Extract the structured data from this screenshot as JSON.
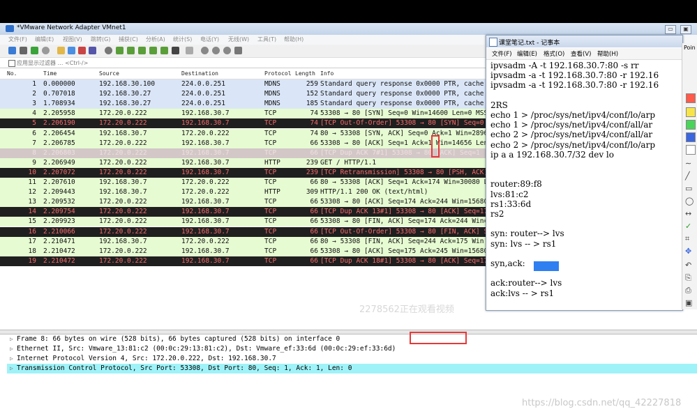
{
  "wireshark": {
    "title": "*VMware Network Adapter VMnet1",
    "menu": [
      "文件(F)",
      "编辑(E)",
      "视图(V)",
      "跳转(G)",
      "捕获(C)",
      "分析(A)",
      "统计(S)",
      "电话(Y)",
      "无线(W)",
      "工具(T)",
      "帮助(H)"
    ],
    "filter_placeholder": "应用显示过滤器 … <Ctrl-/>",
    "columns": [
      "No.",
      "Time",
      "Source",
      "Destination",
      "Protocol",
      "Length",
      "Info"
    ],
    "packets": [
      {
        "no": "1",
        "time": "0.000000",
        "src": "192.168.30.100",
        "dst": "224.0.0.251",
        "proto": "MDNS",
        "len": "259",
        "info": "Standard query response 0x0000 PTR, cache"
      },
      {
        "no": "2",
        "time": "0.707018",
        "src": "192.168.30.27",
        "dst": "224.0.0.251",
        "proto": "MDNS",
        "len": "152",
        "info": "Standard query response 0x0000 PTR, cache"
      },
      {
        "no": "3",
        "time": "1.708934",
        "src": "192.168.30.27",
        "dst": "224.0.0.251",
        "proto": "MDNS",
        "len": "185",
        "info": "Standard query response 0x0000 PTR, cache"
      },
      {
        "no": "4",
        "time": "2.205958",
        "src": "172.20.0.222",
        "dst": "192.168.30.7",
        "proto": "TCP",
        "len": "74",
        "info": "53308 → 80 [SYN] Seq=0 Win=14600 Len=0 MSS"
      },
      {
        "no": "5",
        "time": "2.206190",
        "src": "172.20.0.222",
        "dst": "192.168.30.7",
        "proto": "TCP",
        "len": "74",
        "info": "[TCP Out-Of-Order] 53308 → 80 [SYN] Seq=0"
      },
      {
        "no": "6",
        "time": "2.206454",
        "src": "192.168.30.7",
        "dst": "172.20.0.222",
        "proto": "TCP",
        "len": "74",
        "info": "80 → 53308 [SYN, ACK] Seq=0 Ack=1 Win=2896"
      },
      {
        "no": "7",
        "time": "2.206785",
        "src": "172.20.0.222",
        "dst": "192.168.30.7",
        "proto": "TCP",
        "len": "66",
        "info": "53308 → 80 [ACK] Seq=1 Ack=1 Win=14656 Len"
      },
      {
        "no": "8",
        "time": "2.206803",
        "src": "172.20.0.222",
        "dst": "192.168.30.7",
        "proto": "TCP",
        "len": "66",
        "info": "[TCP Dup ACK 7#1] 53308 → 80 [ACK] Seq=1"
      },
      {
        "no": "9",
        "time": "2.206949",
        "src": "172.20.0.222",
        "dst": "192.168.30.7",
        "proto": "HTTP",
        "len": "239",
        "info": "GET / HTTP/1.1"
      },
      {
        "no": "10",
        "time": "2.207072",
        "src": "172.20.0.222",
        "dst": "192.168.30.7",
        "proto": "TCP",
        "len": "239",
        "info": "[TCP Retransmission] 53308 → 80 [PSH, ACK]"
      },
      {
        "no": "11",
        "time": "2.207610",
        "src": "192.168.30.7",
        "dst": "172.20.0.222",
        "proto": "TCP",
        "len": "66",
        "info": "80 → 53308 [ACK] Seq=1 Ack=174 Win=30080 L"
      },
      {
        "no": "12",
        "time": "2.209443",
        "src": "192.168.30.7",
        "dst": "172.20.0.222",
        "proto": "HTTP",
        "len": "309",
        "info": "HTTP/1.1 200 OK  (text/html)"
      },
      {
        "no": "13",
        "time": "2.209532",
        "src": "172.20.0.222",
        "dst": "192.168.30.7",
        "proto": "TCP",
        "len": "66",
        "info": "53308 → 80 [ACK] Seq=174 Ack=244 Win=15680"
      },
      {
        "no": "14",
        "time": "2.209754",
        "src": "172.20.0.222",
        "dst": "192.168.30.7",
        "proto": "TCP",
        "len": "66",
        "info": "[TCP Dup ACK 13#1] 53308 → 80 [ACK] Seq=17"
      },
      {
        "no": "15",
        "time": "2.209923",
        "src": "172.20.0.222",
        "dst": "192.168.30.7",
        "proto": "TCP",
        "len": "66",
        "info": "53308 → 80 [FIN, ACK] Seq=174 Ack=244 Win="
      },
      {
        "no": "16",
        "time": "2.210066",
        "src": "172.20.0.222",
        "dst": "192.168.30.7",
        "proto": "TCP",
        "len": "66",
        "info": "[TCP Out-Of-Order] 53308 → 80 [FIN, ACK] S"
      },
      {
        "no": "17",
        "time": "2.210471",
        "src": "192.168.30.7",
        "dst": "172.20.0.222",
        "proto": "TCP",
        "len": "66",
        "info": "80 → 53308 [FIN, ACK] Seq=244 Ack=175 Win"
      },
      {
        "no": "18",
        "time": "2.210472",
        "src": "172.20.0.222",
        "dst": "192.168.30.7",
        "proto": "TCP",
        "len": "66",
        "info": "53308 → 80 [ACK] Seq=175 Ack=245 Win=15680"
      },
      {
        "no": "19",
        "time": "2.210472",
        "src": "172.20.0.222",
        "dst": "192.168.30.7",
        "proto": "TCP",
        "len": "66",
        "info": "[TCP Dup ACK 18#1] 53308 → 80 [ACK] Seq=17"
      }
    ],
    "row_styles": [
      "mdns",
      "mdns",
      "mdns",
      "tcp",
      "bad",
      "tcp",
      "tcp",
      "sel",
      "http",
      "bad",
      "tcp",
      "http",
      "tcp",
      "bad",
      "tcp",
      "bad",
      "tcp",
      "tcp",
      "bad"
    ],
    "details": [
      "Frame 8: 66 bytes on wire (528 bits), 66 bytes captured (528 bits) on interface 0",
      "Ethernet II, Src: Vmware_13:81:c2 (00:0c:29:13:81:c2), Dst: Vmware_ef:33:6d (00:0c:29:ef:33:6d)",
      "Internet Protocol Version 4, Src: 172.20.0.222, Dst: 192.168.30.7",
      "Transmission Control Protocol, Src Port: 53308, Dst Port: 80, Seq: 1, Ack: 1, Len: 0"
    ],
    "viewer_overlay": "2278562正在观看视频"
  },
  "notepad": {
    "title": "课堂笔记.txt - 记事本",
    "menu": [
      "文件(F)",
      "编辑(E)",
      "格式(O)",
      "查看(V)",
      "帮助(H)"
    ],
    "lines": [
      "ipvsadm -A -t 192.168.30.7:80 -s rr",
      "ipvsadm -a -t 192.168.30.7:80 -r 192.16",
      "ipvsadm -a -t 192.168.30.7:80 -r 192.16",
      "",
      "2RS",
      "echo 1 > /proc/sys/net/ipv4/conf/lo/arp",
      "echo 1 > /proc/sys/net/ipv4/conf/all/ar",
      "echo 2 > /proc/sys/net/ipv4/conf/all/ar",
      "echo 2 > /proc/sys/net/ipv4/conf/lo/arp",
      "ip a a 192.168.30.7/32 dev lo",
      "",
      "",
      "router:89:f8",
      "lvs:81:c2",
      "rs1:33:6d",
      "rs2",
      "",
      "syn: router--> lvs",
      "syn: lvs -- > rs1",
      "",
      "syn,ack:",
      "",
      "ack:router--> lvs",
      "ack:lvs -- > rs1"
    ]
  },
  "side_toolbar": {
    "label": "Poin"
  },
  "watermark": "https://blog.csdn.net/qq_42227818",
  "colors": {
    "tcp": "#e6fbd2",
    "mdns": "#dae6f7",
    "bad": "#1f1f1f",
    "bad_text": "#f66b6b",
    "highlight": "#9ff3f8",
    "annotation": "#e53939"
  }
}
